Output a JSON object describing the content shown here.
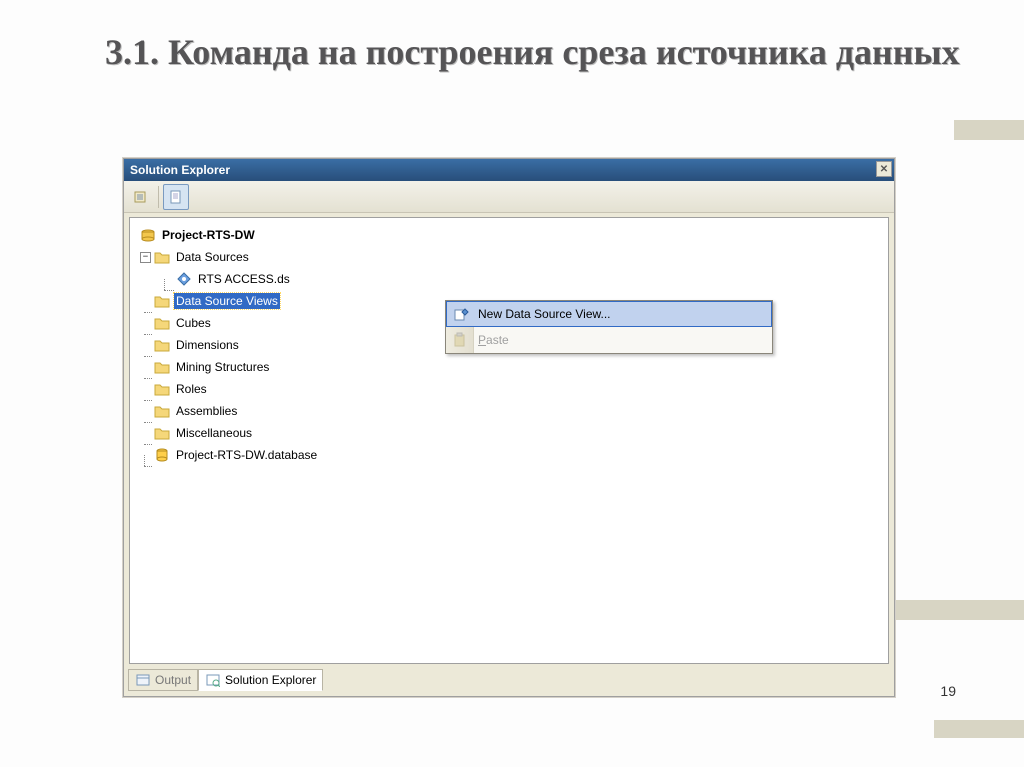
{
  "slide": {
    "title": "3.1. Команда на построения среза источника данных",
    "page_number": "19"
  },
  "panel": {
    "title": "Solution Explorer"
  },
  "tree": {
    "project": "Project-RTS-DW",
    "nodes": {
      "data_sources": "Data Sources",
      "rts_access": "RTS ACCESS.ds",
      "data_source_views": "Data Source Views",
      "cubes": "Cubes",
      "dimensions": "Dimensions",
      "mining": "Mining Structures",
      "roles": "Roles",
      "assemblies": "Assemblies",
      "misc": "Miscellaneous",
      "database": "Project-RTS-DW.database"
    }
  },
  "context_menu": {
    "new_dsv": "New Data Source View...",
    "paste": "Paste",
    "paste_key": "P"
  },
  "tabs": {
    "output": "Output",
    "solution_explorer": "Solution Explorer"
  }
}
